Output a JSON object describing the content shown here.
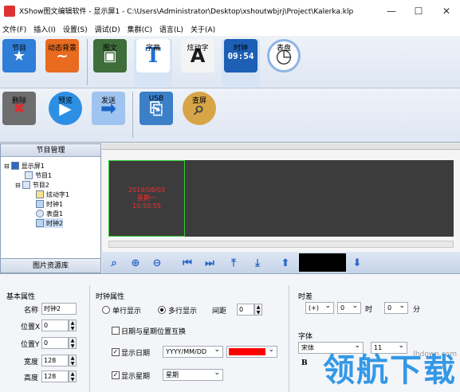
{
  "window": {
    "title": "XShow图文编辑软件 - 显示屏1 - C:\\Users\\Administrator\\Desktop\\xshoutwbjrj\\Project\\Kalerka.klp",
    "minimize": "—",
    "maximize": "☐",
    "close": "✕"
  },
  "menu": [
    "文件(F)",
    "插入(I)",
    "设置(S)",
    "调试(D)",
    "集群(C)",
    "语言(L)",
    "关于(A)"
  ],
  "toolbar1": {
    "items": [
      {
        "label": "节目",
        "icon": "program-icon",
        "glyph": "★"
      },
      {
        "label": "动态背景",
        "icon": "dynamic-background-icon",
        "glyph": "~"
      },
      {
        "label": "图文",
        "icon": "image-text-icon",
        "glyph": "▣"
      },
      {
        "label": "字幕",
        "icon": "subtitle-icon",
        "glyph": "T"
      },
      {
        "label": "炫动字",
        "icon": "animated-text-icon",
        "glyph": "A"
      },
      {
        "label": "时钟",
        "icon": "digital-clock-icon",
        "glyph": "09:54"
      },
      {
        "label": "表盘",
        "icon": "analog-clock-icon",
        "glyph": "◷"
      }
    ]
  },
  "toolbar2": {
    "items": [
      {
        "label": "删除",
        "icon": "delete-icon",
        "glyph": "✖"
      },
      {
        "label": "预览",
        "icon": "preview-icon",
        "glyph": "▶"
      },
      {
        "label": "发送",
        "icon": "send-icon",
        "glyph": "➡"
      },
      {
        "label": "USB",
        "icon": "usb-icon",
        "glyph": "⎘"
      },
      {
        "label": "查屏",
        "icon": "search-screen-icon",
        "glyph": "⌕"
      }
    ]
  },
  "left_panel": {
    "title": "节目管理",
    "tree": [
      {
        "label": "显示屏1",
        "expander": "⊟"
      },
      {
        "label": "节目1",
        "expander": ""
      },
      {
        "label": "节目2",
        "expander": "⊟"
      },
      {
        "label": "炫动字1",
        "expander": ""
      },
      {
        "label": "时钟1",
        "expander": ""
      },
      {
        "label": "表盘1",
        "expander": ""
      },
      {
        "label": "时钟2",
        "expander": ""
      }
    ],
    "library_button": "图片资源库"
  },
  "preview": {
    "line1": "2019/08/03",
    "line2": "星期一",
    "line3": "10:50:55"
  },
  "playbar": {
    "buttons": [
      {
        "name": "zoom-fit-button",
        "glyph": "⌕"
      },
      {
        "name": "zoom-in-button",
        "glyph": "⊕"
      },
      {
        "name": "zoom-out-button",
        "glyph": "⊖"
      },
      {
        "name": "first-button",
        "glyph": "⏮"
      },
      {
        "name": "last-button",
        "glyph": "⏭"
      },
      {
        "name": "move-top-button",
        "glyph": "⤒"
      },
      {
        "name": "move-bottom-button",
        "glyph": "⤓"
      },
      {
        "name": "move-up-button",
        "glyph": "⬆"
      },
      {
        "name": "move-down-button",
        "glyph": "⬇"
      }
    ]
  },
  "basic_props": {
    "title": "基本属性",
    "name_label": "名称",
    "name_value": "时钟2",
    "x_label": "位置X",
    "x_value": "0",
    "y_label": "位置Y",
    "y_value": "0",
    "width_label": "宽度",
    "width_value": "128",
    "height_label": "高度",
    "height_value": "128"
  },
  "clock_props": {
    "title": "时钟属性",
    "single_line": "单行显示",
    "multi_line": "多行显示",
    "spacing_label": "间距",
    "spacing_value": "0",
    "swap_label": "日期与星期位置互换",
    "show_date_label": "显示日期",
    "date_format": "YYYY/MM/DD",
    "show_week_label": "显示星期",
    "week_format": "星期",
    "date_color": "#ff0000"
  },
  "time_diff": {
    "title": "时差",
    "sign": "(+)",
    "hours_value": "0",
    "hours_label": "时",
    "minutes_value": "0",
    "minutes_label": "分"
  },
  "font_props": {
    "title": "字体",
    "font_value": "宋体",
    "size_value": "11",
    "bold_label": "B"
  },
  "watermark": {
    "text": "领航下载",
    "url": "lhdown.com"
  }
}
